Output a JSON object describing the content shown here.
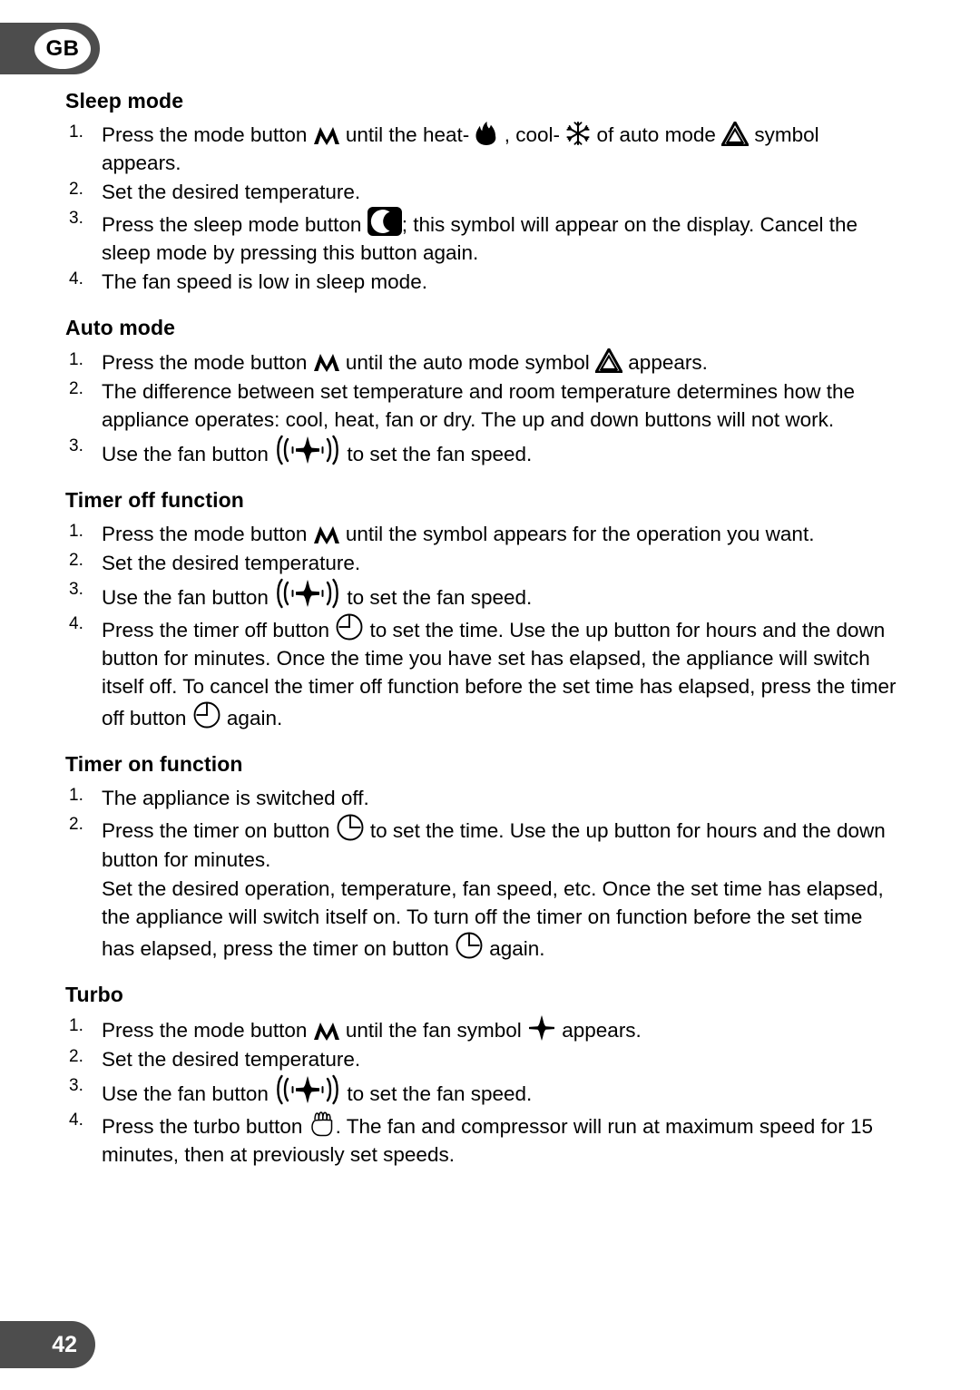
{
  "page": {
    "language_badge": "GB",
    "page_number": "42"
  },
  "icons": {
    "mode_button": "mode-button-icon",
    "heat": "flame-icon",
    "cool": "snowflake-icon",
    "auto_mode": "triangle-auto-icon",
    "sleep_button": "crescent-moon-button-icon",
    "fan_button": "fan-button-icon",
    "fan_symbol": "propeller-fan-icon",
    "timer_off_button": "clock-timer-off-icon",
    "timer_on_button": "clock-timer-on-icon",
    "turbo_button": "fist-turbo-icon"
  },
  "sections": [
    {
      "title": "Sleep mode",
      "steps": [
        {
          "num": "1.",
          "parts": [
            {
              "t": "text",
              "v": "Press the mode button "
            },
            {
              "t": "icon",
              "v": "mode_button"
            },
            {
              "t": "text",
              "v": " until the heat- "
            },
            {
              "t": "icon",
              "v": "heat"
            },
            {
              "t": "text",
              "v": " , cool- "
            },
            {
              "t": "icon",
              "v": "cool"
            },
            {
              "t": "text",
              "v": " of auto mode "
            },
            {
              "t": "icon",
              "v": "auto_mode"
            },
            {
              "t": "text",
              "v": " symbol appears."
            }
          ]
        },
        {
          "num": "2.",
          "parts": [
            {
              "t": "text",
              "v": "Set the desired temperature."
            }
          ]
        },
        {
          "num": "3.",
          "parts": [
            {
              "t": "text",
              "v": "Press the sleep mode button "
            },
            {
              "t": "icon",
              "v": "sleep_button"
            },
            {
              "t": "text",
              "v": "; this symbol will appear on the display. Cancel the sleep mode by pressing this button again."
            }
          ]
        },
        {
          "num": "4.",
          "parts": [
            {
              "t": "text",
              "v": "The fan speed is low in sleep mode."
            }
          ]
        }
      ]
    },
    {
      "title": "Auto mode",
      "steps": [
        {
          "num": "1.",
          "parts": [
            {
              "t": "text",
              "v": "Press the mode button "
            },
            {
              "t": "icon",
              "v": "mode_button"
            },
            {
              "t": "text",
              "v": " until the auto mode symbol "
            },
            {
              "t": "icon",
              "v": "auto_mode"
            },
            {
              "t": "text",
              "v": " appears."
            }
          ]
        },
        {
          "num": "2.",
          "parts": [
            {
              "t": "text",
              "v": "The difference between set temperature and room temperature determines how the appliance operates: cool, heat, fan or dry. The up and down buttons will not work."
            }
          ]
        },
        {
          "num": "3.",
          "parts": [
            {
              "t": "text",
              "v": "Use the fan button "
            },
            {
              "t": "icon",
              "v": "fan_button"
            },
            {
              "t": "text",
              "v": " to set the fan speed."
            }
          ]
        }
      ]
    },
    {
      "title": "Timer off function",
      "steps": [
        {
          "num": "1.",
          "parts": [
            {
              "t": "text",
              "v": "Press the mode button "
            },
            {
              "t": "icon",
              "v": "mode_button"
            },
            {
              "t": "text",
              "v": " until the symbol appears for the operation you want."
            }
          ]
        },
        {
          "num": "2.",
          "parts": [
            {
              "t": "text",
              "v": "Set the desired temperature."
            }
          ]
        },
        {
          "num": "3.",
          "parts": [
            {
              "t": "text",
              "v": "Use the fan button "
            },
            {
              "t": "icon",
              "v": "fan_button"
            },
            {
              "t": "text",
              "v": " to set the fan speed."
            }
          ]
        },
        {
          "num": "4.",
          "parts": [
            {
              "t": "text",
              "v": "Press the timer off button "
            },
            {
              "t": "icon",
              "v": "timer_off_button"
            },
            {
              "t": "text",
              "v": " to set the time. Use the up button for hours and the down button for minutes. Once the time you have set has elapsed, the appliance will switch itself off. To cancel the timer off function before the set time has elapsed, press the timer off button "
            },
            {
              "t": "icon",
              "v": "timer_off_button"
            },
            {
              "t": "text",
              "v": " again."
            }
          ]
        }
      ]
    },
    {
      "title": "Timer on function",
      "steps": [
        {
          "num": "1.",
          "parts": [
            {
              "t": "text",
              "v": "The appliance is switched off."
            }
          ]
        },
        {
          "num": "2.",
          "parts": [
            {
              "t": "text",
              "v": "Press the timer on button "
            },
            {
              "t": "icon",
              "v": "timer_on_button"
            },
            {
              "t": "text",
              "v": " to set the time. Use the up button for hours and the down button for minutes."
            }
          ],
          "continuation": [
            {
              "t": "text",
              "v": "Set the desired operation, temperature, fan speed, etc. Once the set time has elapsed, the appliance will switch itself on. To turn off the timer on function before the set time has elapsed, press the timer on button "
            },
            {
              "t": "icon",
              "v": "timer_on_button"
            },
            {
              "t": "text",
              "v": " again."
            }
          ]
        }
      ]
    },
    {
      "title": "Turbo",
      "steps": [
        {
          "num": "1.",
          "parts": [
            {
              "t": "text",
              "v": "Press the mode button "
            },
            {
              "t": "icon",
              "v": "mode_button"
            },
            {
              "t": "text",
              "v": " until the fan symbol "
            },
            {
              "t": "icon",
              "v": "fan_symbol"
            },
            {
              "t": "text",
              "v": " appears."
            }
          ]
        },
        {
          "num": "2.",
          "parts": [
            {
              "t": "text",
              "v": "Set the desired temperature."
            }
          ]
        },
        {
          "num": "3.",
          "parts": [
            {
              "t": "text",
              "v": "Use the fan button "
            },
            {
              "t": "icon",
              "v": "fan_button"
            },
            {
              "t": "text",
              "v": " to set the fan speed."
            }
          ]
        },
        {
          "num": "4.",
          "parts": [
            {
              "t": "text",
              "v": "Press the turbo button "
            },
            {
              "t": "icon",
              "v": "turbo_button"
            },
            {
              "t": "text",
              "v": ". The fan and compressor will run at maximum speed for 15 minutes, then at previously set speeds."
            }
          ]
        }
      ]
    }
  ]
}
